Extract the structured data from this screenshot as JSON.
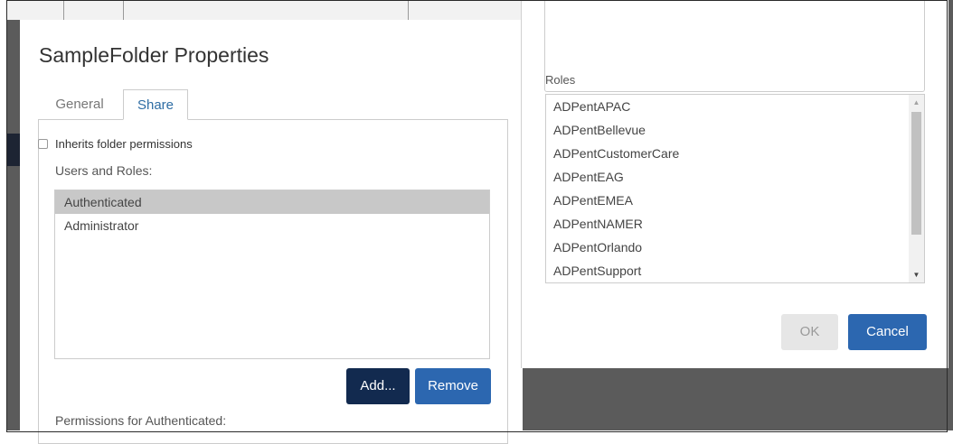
{
  "properties_dialog": {
    "title": "SampleFolder Properties",
    "tabs": [
      {
        "label": "General",
        "active": false
      },
      {
        "label": "Share",
        "active": true
      }
    ],
    "inherit_label": "Inherits folder permissions",
    "inherit_checked": false,
    "users_roles_label": "Users and Roles:",
    "users_roles": [
      {
        "name": "Authenticated",
        "selected": true
      },
      {
        "name": "Administrator",
        "selected": false
      }
    ],
    "add_label": "Add...",
    "remove_label": "Remove",
    "permissions_label": "Permissions for Authenticated:"
  },
  "roles_dialog": {
    "roles_label": "Roles",
    "roles": [
      "ADPentAPAC",
      "ADPentBellevue",
      "ADPentCustomerCare",
      "ADPentEAG",
      "ADPentEMEA",
      "ADPentNAMER",
      "ADPentOrlando",
      "ADPentSupport"
    ],
    "ok_label": "OK",
    "ok_enabled": false,
    "cancel_label": "Cancel"
  },
  "colors": {
    "primary_button": "#2c67b0",
    "dark_button": "#122a4f",
    "selected_row": "#c8c8c8",
    "overlay": "#5b5b5b",
    "active_tab_text": "#2e6da4"
  }
}
